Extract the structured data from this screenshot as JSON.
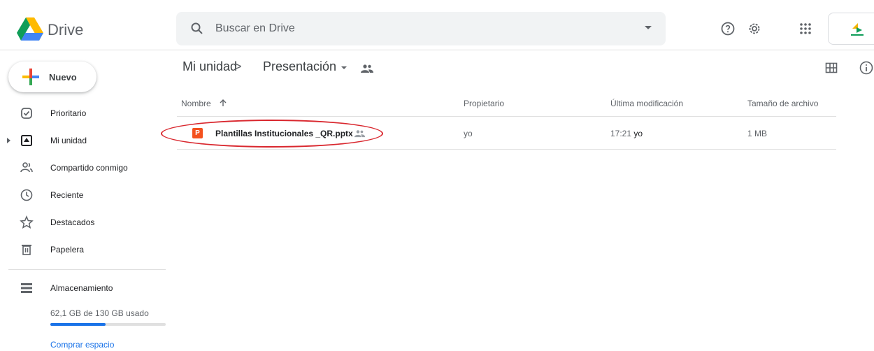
{
  "app": {
    "brand": "Drive",
    "colors": {
      "accent": "#1a73e8",
      "pptx": "#f4511e",
      "highlight": "#d9272e"
    }
  },
  "header": {
    "search_placeholder": "Buscar en Drive",
    "icons": [
      "search-icon",
      "help-icon",
      "settings-icon",
      "apps-icon"
    ]
  },
  "sidebar": {
    "new_label": "Nuevo",
    "items": [
      {
        "label": "Prioritario",
        "icon": "check-circle-icon"
      },
      {
        "label": "Mi unidad",
        "icon": "drive-icon"
      },
      {
        "label": "Compartido conmigo",
        "icon": "people-icon"
      },
      {
        "label": "Reciente",
        "icon": "clock-icon"
      },
      {
        "label": "Destacados",
        "icon": "star-icon"
      },
      {
        "label": "Papelera",
        "icon": "trash-icon"
      }
    ],
    "storage": {
      "label": "Almacenamiento",
      "usage_text": "62,1 GB de 130 GB usado",
      "used_fraction": 0.478,
      "buy_label": "Comprar espacio"
    }
  },
  "breadcrumb": {
    "root": "Mi unidad",
    "separator": ">",
    "current": "Presentación"
  },
  "table": {
    "headers": {
      "name": "Nombre",
      "owner": "Propietario",
      "modified": "Última modificación",
      "size": "Tamaño de archivo"
    },
    "rows": [
      {
        "icon_letter": "P",
        "name": "Plantillas Institucionales _QR.pptx",
        "owner": "yo",
        "modified_time": "17:21",
        "modified_by": "yo",
        "size": "1 MB"
      }
    ]
  }
}
